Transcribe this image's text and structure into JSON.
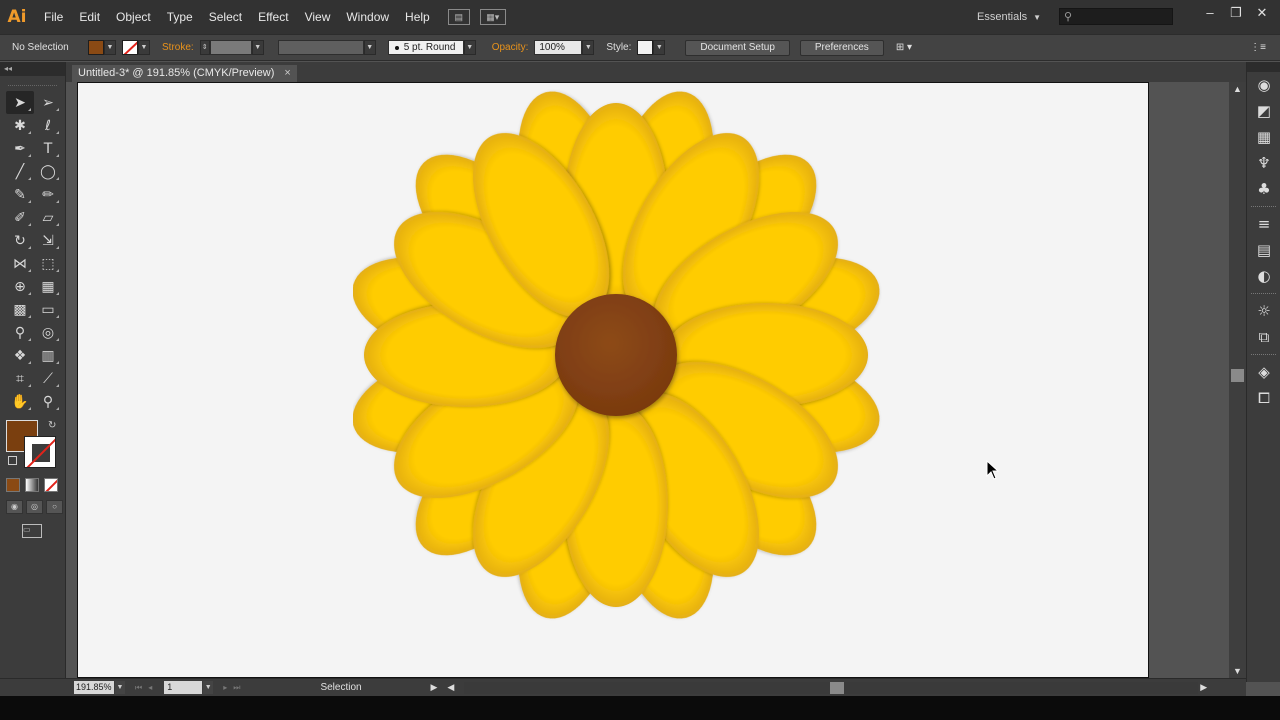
{
  "app": {
    "logo_text": "Ai",
    "accent_color": "#f09a2a"
  },
  "menubar": {
    "items": [
      "File",
      "Edit",
      "Object",
      "Type",
      "Select",
      "Effect",
      "View",
      "Window",
      "Help"
    ],
    "workspace_label": "Essentials",
    "search_placeholder": ""
  },
  "controlbar": {
    "selection_label": "No Selection",
    "fill_color": "#8a4a14",
    "stroke_label": "Stroke:",
    "brush_label": "5 pt. Round",
    "opacity_label": "Opacity:",
    "opacity_value": "100%",
    "style_label": "Style:",
    "document_setup_label": "Document Setup",
    "preferences_label": "Preferences"
  },
  "document": {
    "tab_title": "Untitled-3* @ 191.85% (CMYK/Preview)",
    "close_glyph": "×"
  },
  "tools": {
    "fill_color": "#7a3f0f",
    "items": [
      {
        "name": "selection-tool",
        "glyph": "➤"
      },
      {
        "name": "direct-selection-tool",
        "glyph": "➢"
      },
      {
        "name": "magic-wand-tool",
        "glyph": "✱"
      },
      {
        "name": "lasso-tool",
        "glyph": "ℓ"
      },
      {
        "name": "pen-tool",
        "glyph": "✒"
      },
      {
        "name": "type-tool",
        "glyph": "T"
      },
      {
        "name": "line-segment-tool",
        "glyph": "╱"
      },
      {
        "name": "ellipse-tool",
        "glyph": "◯"
      },
      {
        "name": "paintbrush-tool",
        "glyph": "✎"
      },
      {
        "name": "pencil-tool",
        "glyph": "✏"
      },
      {
        "name": "blob-brush-tool",
        "glyph": "✐"
      },
      {
        "name": "eraser-tool",
        "glyph": "▱"
      },
      {
        "name": "rotate-tool",
        "glyph": "↻"
      },
      {
        "name": "scale-tool",
        "glyph": "⇲"
      },
      {
        "name": "width-tool",
        "glyph": "⋈"
      },
      {
        "name": "free-transform-tool",
        "glyph": "⬚"
      },
      {
        "name": "shape-builder-tool",
        "glyph": "⊕"
      },
      {
        "name": "perspective-grid-tool",
        "glyph": "▦"
      },
      {
        "name": "mesh-tool",
        "glyph": "▩"
      },
      {
        "name": "gradient-tool",
        "glyph": "▭"
      },
      {
        "name": "eyedropper-tool",
        "glyph": "⚲"
      },
      {
        "name": "blend-tool",
        "glyph": "◎"
      },
      {
        "name": "symbol-sprayer-tool",
        "glyph": "❖"
      },
      {
        "name": "column-graph-tool",
        "glyph": "▥"
      },
      {
        "name": "artboard-tool",
        "glyph": "⌗"
      },
      {
        "name": "slice-tool",
        "glyph": "⟋"
      },
      {
        "name": "hand-tool",
        "glyph": "✋"
      },
      {
        "name": "zoom-tool",
        "glyph": "⚲"
      }
    ]
  },
  "dock": {
    "icons": [
      {
        "name": "color-guide-icon",
        "glyph": "◉"
      },
      {
        "name": "gradient-panel-icon",
        "glyph": "◩"
      },
      {
        "name": "swatches-icon",
        "glyph": "▦"
      },
      {
        "name": "brushes-icon",
        "glyph": "♆"
      },
      {
        "name": "symbols-icon",
        "glyph": "♣"
      },
      {
        "name": "stroke-panel-icon",
        "glyph": "≡"
      },
      {
        "name": "gradient-icon",
        "glyph": "▤"
      },
      {
        "name": "transparency-icon",
        "glyph": "◐"
      },
      {
        "name": "appearance-icon",
        "glyph": "☼"
      },
      {
        "name": "graphic-styles-icon",
        "glyph": "⧉"
      },
      {
        "name": "layers-icon",
        "glyph": "◈"
      },
      {
        "name": "artboards-icon",
        "glyph": "⧠"
      }
    ]
  },
  "statusbar": {
    "zoom_value": "191.85%",
    "page_value": "1",
    "status_text": "Selection"
  },
  "colors": {
    "petal_light": "#ffcc00",
    "petal_dark": "#d8a21e",
    "center": "#7a3a10"
  }
}
